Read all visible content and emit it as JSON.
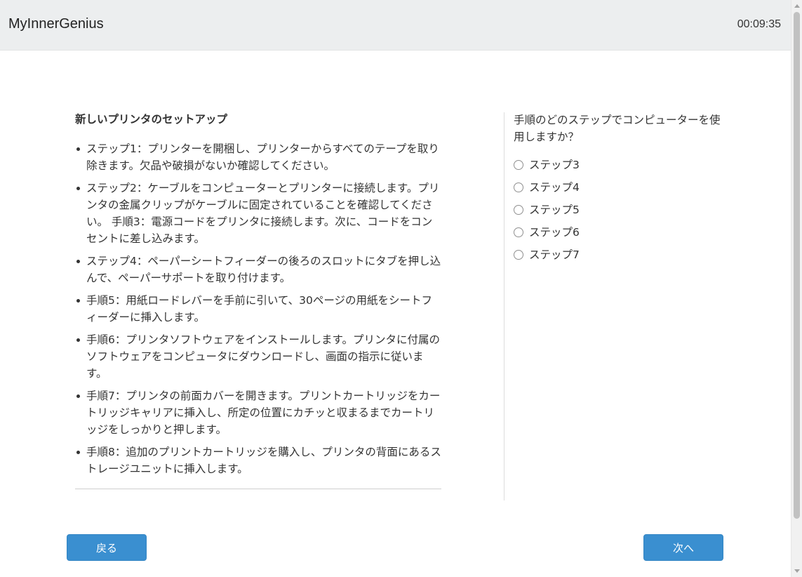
{
  "header": {
    "app_title": "MyInnerGenius",
    "timer": "00:09:35"
  },
  "passage": {
    "title": "新しいプリンタのセットアップ",
    "steps": [
      "ステップ1：プリンターを開梱し、プリンターからすべてのテープを取り除きます。欠品や破損がないか確認してください。",
      "ステップ2：ケーブルをコンピューターとプリンターに接続します。プリンタの金属クリップがケーブルに固定されていることを確認してください。 手順3：電源コードをプリンタに接続します。次に、コードをコンセントに差し込みます。",
      "ステップ4：ペーパーシートフィーダーの後ろのスロットにタブを押し込んで、ペーパーサポートを取り付けます。",
      "手順5：用紙ロードレバーを手前に引いて、30ページの用紙をシートフィーダーに挿入します。",
      "手順6：プリンタソフトウェアをインストールします。プリンタに付属のソフトウェアをコンピュータにダウンロードし、画面の指示に従います。",
      "手順7：プリンタの前面カバーを開きます。プリントカートリッジをカートリッジキャリアに挿入し、所定の位置にカチッと収まるまでカートリッジをしっかりと押します。",
      "手順8：追加のプリントカートリッジを購入し、プリンタの背面にあるストレージユニットに挿入します。"
    ]
  },
  "question": {
    "text": "手順のどのステップでコンピューターを使用しますか？",
    "options": [
      "ステップ3",
      "ステップ4",
      "ステップ5",
      "ステップ6",
      "ステップ7"
    ]
  },
  "buttons": {
    "back_label": "戻る",
    "next_label": "次へ"
  },
  "colors": {
    "button_blue": "#3a8fd0",
    "header_bg": "#eceeef"
  }
}
